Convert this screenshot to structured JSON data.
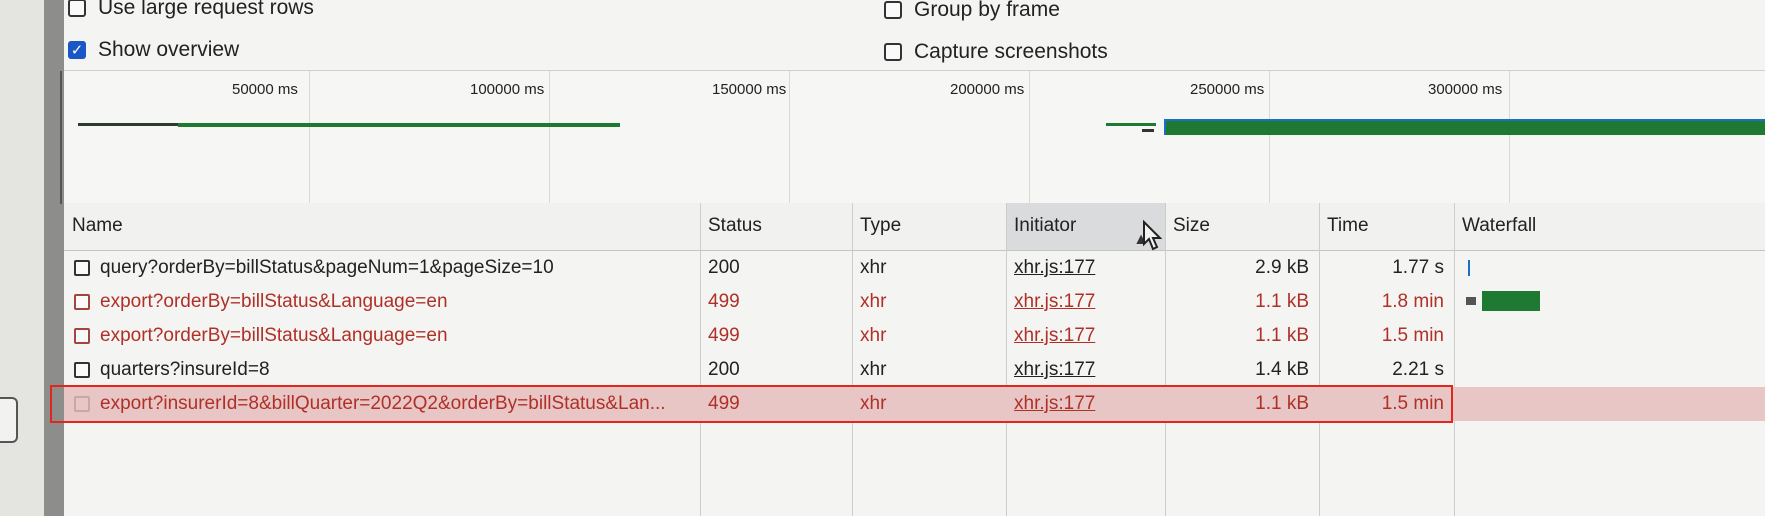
{
  "settings": {
    "use_large_rows": {
      "label": "Use large request rows",
      "checked": false
    },
    "show_overview": {
      "label": "Show overview",
      "checked": true
    },
    "group_by_frame": {
      "label": "Group by frame",
      "checked": false
    },
    "capture_screenshots": {
      "label": "Capture screenshots",
      "checked": false
    }
  },
  "overview": {
    "ticks": [
      "50000 ms",
      "100000 ms",
      "150000 ms",
      "200000 ms",
      "250000 ms",
      "300000 ms"
    ]
  },
  "table": {
    "columns": {
      "name": "Name",
      "status": "Status",
      "type": "Type",
      "initiator": "Initiator",
      "size": "Size",
      "time": "Time",
      "waterfall": "Waterfall"
    },
    "sort_column": "initiator",
    "sort_icon": "sort-ascending-icon",
    "rows": [
      {
        "name": "query?orderBy=billStatus&pageNum=1&pageSize=10",
        "status": "200",
        "type": "xhr",
        "initiator": "xhr.js:177",
        "size": "2.9 kB",
        "time": "1.77 s"
      },
      {
        "name": "export?orderBy=billStatus&Language=en",
        "status": "499",
        "type": "xhr",
        "initiator": "xhr.js:177",
        "size": "1.1 kB",
        "time": "1.8 min"
      },
      {
        "name": "export?orderBy=billStatus&Language=en",
        "status": "499",
        "type": "xhr",
        "initiator": "xhr.js:177",
        "size": "1.1 kB",
        "time": "1.5 min"
      },
      {
        "name": "quarters?insureId=8",
        "status": "200",
        "type": "xhr",
        "initiator": "xhr.js:177",
        "size": "1.4 kB",
        "time": "2.21 s"
      },
      {
        "name": "export?insurerId=8&billQuarter=2022Q2&orderBy=billStatus&Lan...",
        "status": "499",
        "type": "xhr",
        "initiator": "xhr.js:177",
        "size": "1.1 kB",
        "time": "1.5 min"
      }
    ]
  },
  "colors": {
    "error_text": "#b03028",
    "selected_row": "#e8c6c6",
    "highlight_border": "#e0261d",
    "overview_green": "#1e7a32",
    "overview_blue": "#1a6fc9",
    "checkbox_checked": "#1a56c5"
  }
}
